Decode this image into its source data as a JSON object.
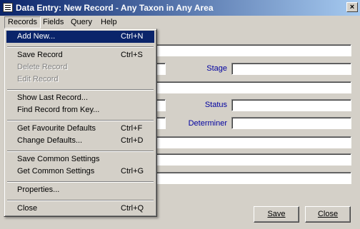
{
  "window": {
    "title": "Data Entry: New Record - Any Taxon in Any Area",
    "close_glyph": "×"
  },
  "menubar": {
    "items": [
      "Records",
      "Fields",
      "Query",
      "Help"
    ]
  },
  "form": {
    "labels": {
      "stage": "Stage",
      "status": "Status",
      "determiner": "Determiner"
    },
    "buttons": {
      "save": "Save",
      "close": "Close"
    }
  },
  "records_menu": {
    "items": [
      {
        "label": "Add New...",
        "shortcut": "Ctrl+N",
        "state": "highlighted"
      },
      {
        "label": "Save Record",
        "shortcut": "Ctrl+S",
        "state": "normal"
      },
      {
        "label": "Delete Record",
        "shortcut": "",
        "state": "disabled"
      },
      {
        "label": "Edit Record",
        "shortcut": "",
        "state": "disabled"
      },
      {
        "label": "Show Last Record...",
        "shortcut": "",
        "state": "normal"
      },
      {
        "label": "Find Record from Key...",
        "shortcut": "",
        "state": "normal"
      },
      {
        "label": "Get Favourite Defaults",
        "shortcut": "Ctrl+F",
        "state": "normal"
      },
      {
        "label": "Change Defaults...",
        "shortcut": "Ctrl+D",
        "state": "normal"
      },
      {
        "label": "Save Common Settings",
        "shortcut": "",
        "state": "normal"
      },
      {
        "label": "Get Common Settings",
        "shortcut": "Ctrl+G",
        "state": "normal"
      },
      {
        "label": "Properties...",
        "shortcut": "",
        "state": "normal"
      },
      {
        "label": "Close",
        "shortcut": "Ctrl+Q",
        "state": "normal"
      }
    ]
  }
}
